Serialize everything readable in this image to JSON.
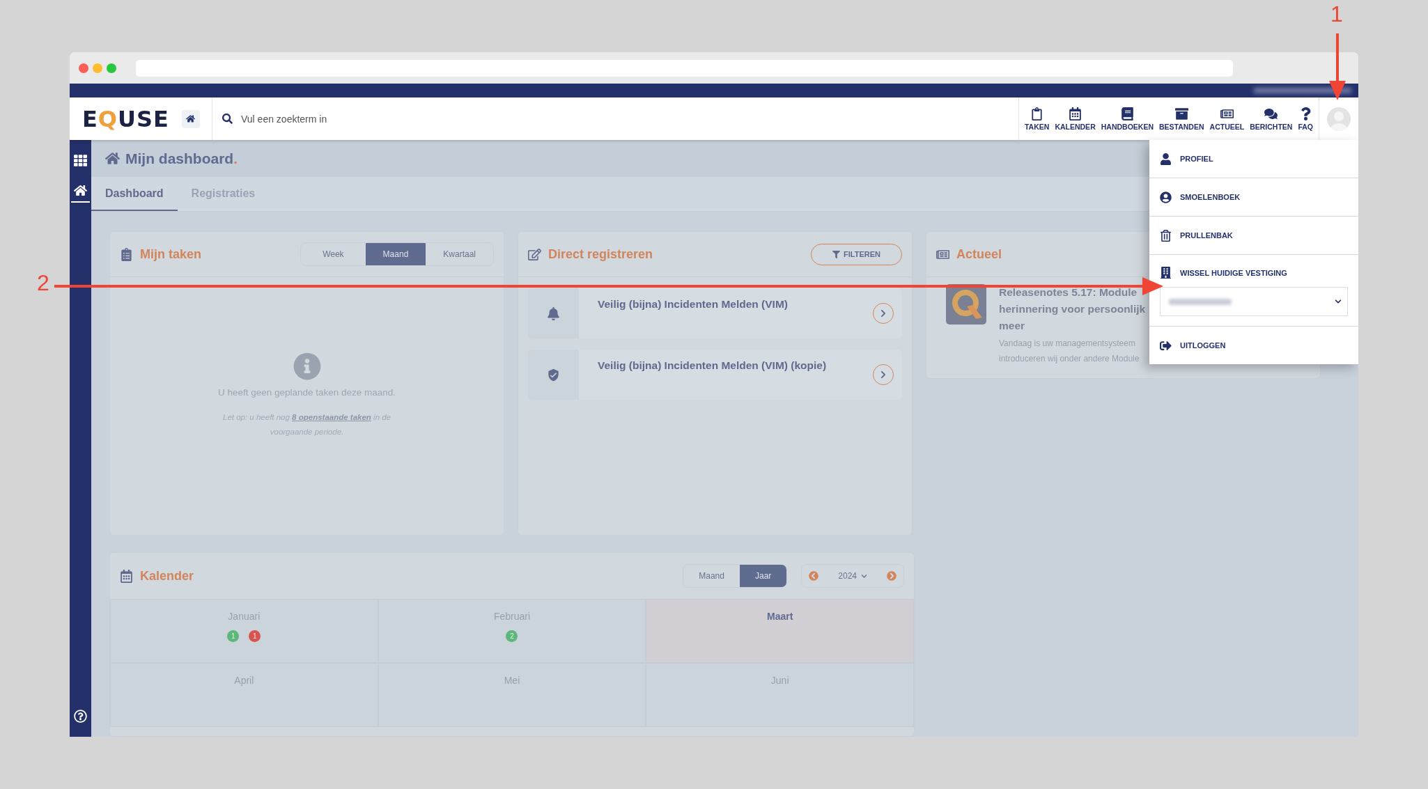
{
  "annotations": [
    {
      "label": "1"
    },
    {
      "label": "2"
    }
  ],
  "header": {
    "logo": "EQUSE",
    "search": {
      "placeholder": "Vul een zoekterm in"
    },
    "nav": [
      {
        "kind": "tasks",
        "label": "TAKEN"
      },
      {
        "kind": "calendar",
        "label": "KALENDER"
      },
      {
        "kind": "book",
        "label": "HANDBOEKEN"
      },
      {
        "kind": "archive",
        "label": "BESTANDEN"
      },
      {
        "kind": "news",
        "label": "ACTUEEL"
      },
      {
        "kind": "chat",
        "label": "BERICHTEN"
      },
      {
        "kind": "help",
        "label": "FAQ"
      }
    ]
  },
  "user_menu": {
    "items": [
      {
        "kind": "user",
        "label": "PROFIEL"
      },
      {
        "kind": "contacts",
        "label": "SMOELENBOEK"
      },
      {
        "kind": "trash",
        "label": "PRULLENBAK"
      },
      {
        "kind": "building",
        "label": "WISSEL HUIDIGE VESTIGING",
        "has_select": true
      },
      {
        "kind": "logout",
        "label": "UITLOGGEN"
      }
    ]
  },
  "page": {
    "title": "Mijn dashboard.",
    "tabs": [
      {
        "label": "Dashboard",
        "selected": true
      },
      {
        "label": "Registraties",
        "selected": false
      }
    ]
  },
  "tasks": {
    "title": "Mijn taken",
    "periods": [
      {
        "label": "Week",
        "selected": false
      },
      {
        "label": "Maand",
        "selected": true
      },
      {
        "label": "Kwartaal",
        "selected": false
      }
    ],
    "empty": "U heeft geen geplande taken deze maand.",
    "note": "Let op: u heeft nog",
    "note_link": "8 openstaande taken",
    "note_end": "in de voorgaande periode."
  },
  "register": {
    "title": "Direct registreren",
    "filter": "FILTEREN",
    "items": [
      {
        "kind": "bell",
        "label": "Veilig (bijna) Incidenten Melden (VIM)"
      },
      {
        "kind": "shield",
        "label": "Veilig (bijna) Incidenten Melden (VIM) (kopie)"
      }
    ]
  },
  "news": {
    "title": "Actueel",
    "items": [
      {
        "kind": "picture",
        "title_lines": [
          "Releasenotes 5.17: Module",
          "herinnering voor persoonlijk",
          "meer"
        ],
        "text_lines": [
          "Vandaag is uw managementsysteem",
          "introduceren wij onder andere Module"
        ]
      }
    ]
  },
  "calendar": {
    "title": "Kalender",
    "views": [
      {
        "label": "Maand",
        "selected": false
      },
      {
        "label": "Jaar",
        "selected": true
      }
    ],
    "year": "2024",
    "months": [
      {
        "name": "Januari",
        "selected": false,
        "badges": [
          {
            "count": "1",
            "kind": "done"
          },
          {
            "count": "1",
            "kind": "overdue"
          }
        ]
      },
      {
        "name": "Februari",
        "selected": false,
        "badges": [
          {
            "count": "2",
            "kind": "done"
          }
        ]
      },
      {
        "name": "Maart",
        "selected": true
      },
      {
        "name": "April",
        "selected": false
      },
      {
        "name": "Mei",
        "selected": false
      },
      {
        "name": "Juni",
        "selected": false
      }
    ]
  }
}
